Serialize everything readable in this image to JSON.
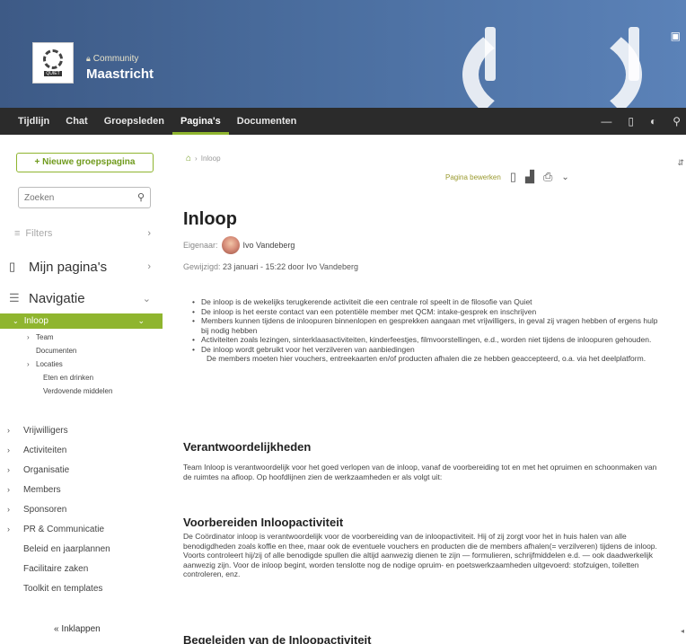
{
  "header": {
    "community_label": "Community",
    "group_name": "Maastricht",
    "logo_tag": "QUIET"
  },
  "nav": {
    "tabs": [
      "Tijdlijn",
      "Chat",
      "Groepsleden",
      "Pagina's",
      "Documenten"
    ],
    "active_tab": "Pagina's"
  },
  "sidebar": {
    "new_page_button": "+ Nieuwe groepspagina",
    "search_placeholder": "Zoeken",
    "filters_label": "Filters",
    "mijn_paginas": "Mijn pagina's",
    "navigatie": "Navigatie",
    "active_item": "Inloop",
    "tree": [
      {
        "label": "Team",
        "level": 1,
        "caret": true
      },
      {
        "label": "Documenten",
        "level": 1,
        "caret": false
      },
      {
        "label": "Locaties",
        "level": 1,
        "caret": true
      },
      {
        "label": "Eten en drinken",
        "level": 2,
        "caret": false
      },
      {
        "label": "Verdovende middelen",
        "level": 2,
        "caret": false
      }
    ],
    "top_items": [
      {
        "label": "Vrijwilligers",
        "caret": true
      },
      {
        "label": "Activiteiten",
        "caret": true
      },
      {
        "label": "Organisatie",
        "caret": true
      },
      {
        "label": "Members",
        "caret": true
      },
      {
        "label": "Sponsoren",
        "caret": true
      },
      {
        "label": "PR & Communicatie",
        "caret": true
      },
      {
        "label": "Beleid en jaarplannen",
        "caret": false
      },
      {
        "label": "Facilitaire zaken",
        "caret": false
      },
      {
        "label": "Toolkit en templates",
        "caret": false
      }
    ],
    "collapse_label": "« Inklappen"
  },
  "content": {
    "breadcrumb": "Inloop",
    "edit_label": "Pagina bewerken",
    "title": "Inloop",
    "owner_label": "Eigenaar:",
    "owner_name": "Ivo Vandeberg",
    "modified_label": "Gewijzigd:",
    "modified_value": "23 januari - 15:22 door Ivo Vandeberg",
    "bullets": [
      "De inloop is de wekelijks terugkerende activiteit die een centrale rol speelt in de filosofie van Quiet",
      "De inloop is het eerste contact van een potentiële member met QCM: intake-gesprek en inschrijven",
      "Members kunnen tijdens de inloopuren binnenlopen en gesprekken aangaan met vrijwilligers, in geval zij vragen hebben of ergens hulp bij nodig hebben",
      "Activiteiten zoals lezingen, sinterklaasactiviteiten, kinderfeestjes, filmvoorstellingen, e.d., worden niet tijdens de inloopuren gehouden.",
      "De inloop wordt gebruikt voor het verzilveren van aanbiedingen"
    ],
    "bullet_followup": "De members moeten hier vouchers, entreekaarten en/of producten afhalen die ze hebben geaccepteerd, o.a. via het deelplatform.",
    "h_verantwoordelijkheden": "Verantwoordelijkheden",
    "p_verantwoordelijkheden": "Team Inloop is verantwoordelijk voor het goed verlopen van de inloop, vanaf de voorbereiding tot en met het opruimen en schoonmaken van de ruimtes na afloop. Op hoofdlijnen zien de werkzaamheden er als volgt uit:",
    "h_voorbereiden": "Voorbereiden Inloopactiviteit",
    "p_voorbereiden": "De Coördinator inloop is verantwoordelijk voor de voorbereiding van de inloopactiviteit. Hij of zij zorgt voor het in huis halen van alle benodigdheden zoals koffie en thee, maar ook de eventuele vouchers en producten die de members afhalen(= verzilveren) tijdens de inloop. Voorts controleert hij/zij of alle benodigde spullen die altijd aanwezig dienen te zijn — formulieren, schrijfmiddelen e.d. — ook daadwerkelijk aanwezig zijn. Voor de inloop begint, worden tenslotte nog de nodige opruim- en poetswerkzaamheden uitgevoerd: stofzuigen, toiletten controleren, enz.",
    "h_begeleiden": "Begeleiden van de Inloopactiviteit"
  }
}
